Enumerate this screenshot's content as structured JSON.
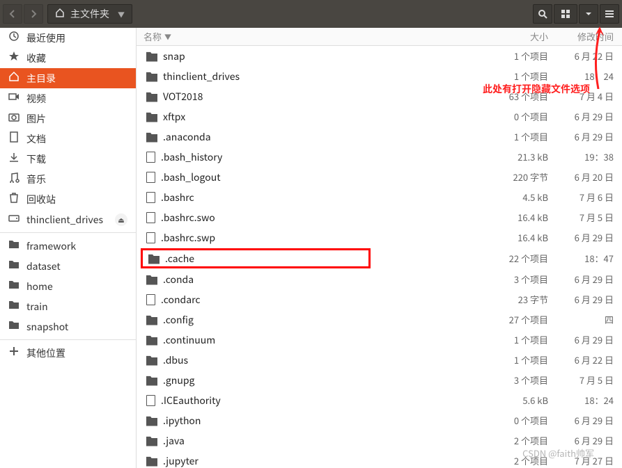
{
  "toolbar": {
    "path_label": "主文件夹"
  },
  "columns": {
    "name": "名称",
    "size": "大小",
    "mtime": "修改时间"
  },
  "sidebar": {
    "main": [
      {
        "icon": "clock",
        "label": "最近使用"
      },
      {
        "icon": "star",
        "label": "收藏"
      },
      {
        "icon": "home",
        "label": "主目录",
        "active": true
      },
      {
        "icon": "video",
        "label": "视频"
      },
      {
        "icon": "camera",
        "label": "图片"
      },
      {
        "icon": "doc",
        "label": "文档"
      },
      {
        "icon": "download",
        "label": "下载"
      },
      {
        "icon": "music",
        "label": "音乐"
      },
      {
        "icon": "trash",
        "label": "回收站"
      },
      {
        "icon": "drive",
        "label": "thinclient_drives",
        "eject": true
      }
    ],
    "bookmarks": [
      {
        "icon": "folder",
        "label": "framework"
      },
      {
        "icon": "folder",
        "label": "dataset"
      },
      {
        "icon": "folder",
        "label": "home"
      },
      {
        "icon": "folder",
        "label": "train"
      },
      {
        "icon": "folder",
        "label": "snapshot"
      }
    ],
    "other": [
      {
        "icon": "plus",
        "label": "其他位置"
      }
    ]
  },
  "files": [
    {
      "type": "folder",
      "name": "snap",
      "size": "1 个项目",
      "mtime": "6 月 22 日"
    },
    {
      "type": "folder",
      "name": "thinclient_drives",
      "size": "1 个项目",
      "mtime": "18：24"
    },
    {
      "type": "folder",
      "name": "VOT2018",
      "size": "63 个项目",
      "mtime": "7 月 4 日"
    },
    {
      "type": "folder",
      "name": "xftpx",
      "size": "0 个项目",
      "mtime": "6 月 29 日"
    },
    {
      "type": "folder",
      "name": ".anaconda",
      "size": "1 个项目",
      "mtime": "6 月 29 日"
    },
    {
      "type": "file",
      "name": ".bash_history",
      "size": "21.3 kB",
      "mtime": "19：38"
    },
    {
      "type": "file",
      "name": ".bash_logout",
      "size": "220 字节",
      "mtime": "6 月 20 日"
    },
    {
      "type": "file",
      "name": ".bashrc",
      "size": "4.5 kB",
      "mtime": "7 月 6 日"
    },
    {
      "type": "file",
      "name": ".bashrc.swo",
      "size": "16.4 kB",
      "mtime": "7 月 5 日"
    },
    {
      "type": "file",
      "name": ".bashrc.swp",
      "size": "16.4 kB",
      "mtime": "6 月 29 日"
    },
    {
      "type": "folder",
      "name": ".cache",
      "size": "22 个项目",
      "mtime": "18：47",
      "highlight": true
    },
    {
      "type": "folder",
      "name": ".conda",
      "size": "3 个项目",
      "mtime": "6 月 29 日"
    },
    {
      "type": "file",
      "name": ".condarc",
      "size": "23 字节",
      "mtime": "6 月 29 日"
    },
    {
      "type": "folder",
      "name": ".config",
      "size": "27 个项目",
      "mtime": "四"
    },
    {
      "type": "folder",
      "name": ".continuum",
      "size": "1 个项目",
      "mtime": "6 月 29 日"
    },
    {
      "type": "folder",
      "name": ".dbus",
      "size": "1 个项目",
      "mtime": "6 月 22 日"
    },
    {
      "type": "folder",
      "name": ".gnupg",
      "size": "3 个项目",
      "mtime": "7 月 5 日"
    },
    {
      "type": "file",
      "name": ".ICEauthority",
      "size": "5.6 kB",
      "mtime": "18：24"
    },
    {
      "type": "folder",
      "name": ".ipython",
      "size": "0 个项目",
      "mtime": "6 月 29 日"
    },
    {
      "type": "folder",
      "name": ".java",
      "size": "2 个项目",
      "mtime": "6 月 29 日"
    },
    {
      "type": "folder",
      "name": ".jupyter",
      "size": "2 个项目",
      "mtime": "7 月 27 日"
    }
  ],
  "annotation": "此处有打开隐藏文件选项",
  "watermark": "CSDN @faith帅军"
}
